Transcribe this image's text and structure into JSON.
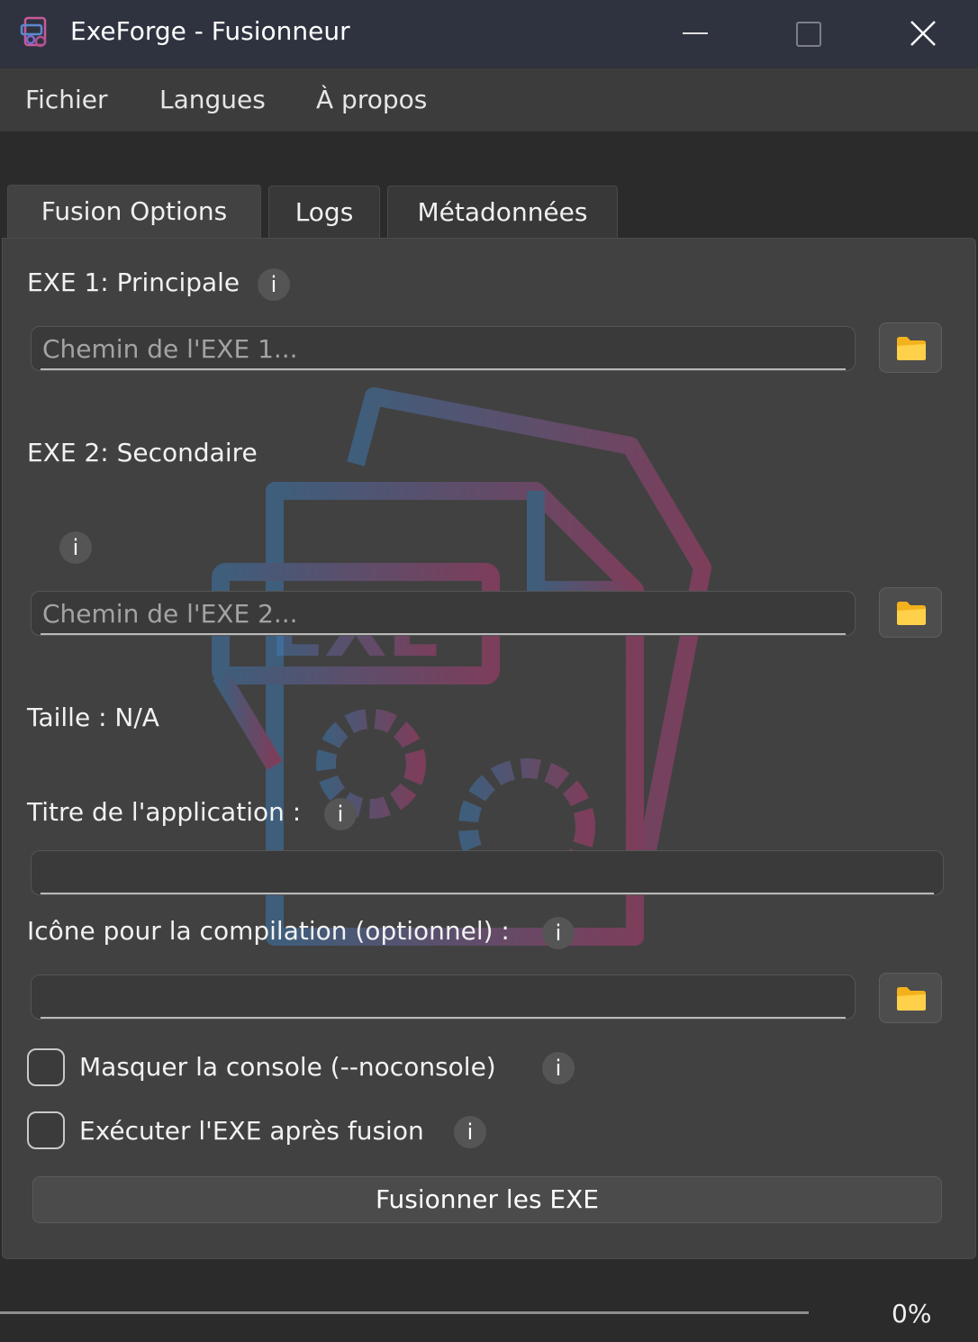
{
  "window": {
    "title": "ExeForge - Fusionneur",
    "accent_colors": [
      "#3b82c4",
      "#c43b7a"
    ]
  },
  "menu": {
    "file": "Fichier",
    "languages": "Langues",
    "about": "À propos"
  },
  "tabs": {
    "fusion": "Fusion  Options",
    "logs": "Logs",
    "metadata": "Métadonnées"
  },
  "form": {
    "exe1_label": "EXE 1: Principale",
    "exe1_placeholder": "Chemin de l'EXE 1...",
    "exe2_label": "EXE 2: Secondaire",
    "exe2_placeholder": "Chemin de l'EXE 2...",
    "size_label": "Taille : N/A",
    "app_title_label": "Titre de l'application :",
    "app_title_value": "",
    "icon_label": "Icône pour la compilation (optionnel) :",
    "icon_value": "",
    "hide_console_label": "Masquer la console (--noconsole)",
    "hide_console_checked": false,
    "run_after_label": "Exécuter l'EXE après fusion",
    "run_after_checked": false,
    "info_glyph": "i",
    "merge_button": "Fusionner les EXE"
  },
  "icons": {
    "browse": "folder-icon",
    "info": "info-icon",
    "watermark": "exe-gears-icon"
  },
  "progress": {
    "value": 0,
    "text": "0%"
  }
}
